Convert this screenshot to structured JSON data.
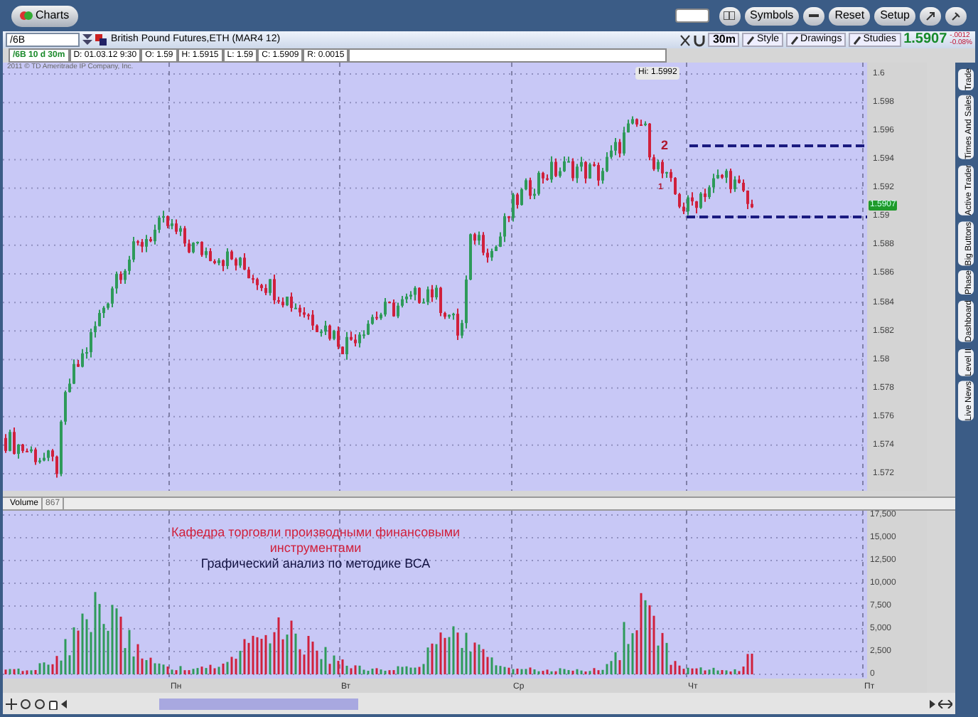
{
  "window": {
    "app_button": "Charts"
  },
  "header_buttons": [
    "Symbols",
    "Reset",
    "Setup"
  ],
  "symbol": {
    "value": "/6B",
    "description": "British Pound Futures,ETH (MAR4 12)"
  },
  "toolbar": {
    "aggregation": "30m",
    "buttons": [
      "Style",
      "Drawings",
      "Studies"
    ]
  },
  "quote": {
    "last": "1.5907",
    "change": "-.0012",
    "change_pct": "-0.08%"
  },
  "info_cells": [
    {
      "text": "/6B 10 d 30m",
      "kind": "title"
    },
    {
      "text": "D: 01.03.12 9:30",
      "kind": "plain"
    },
    {
      "text": "O: 1.59",
      "kind": "plain"
    },
    {
      "text": "H: 1.5915",
      "kind": "plain"
    },
    {
      "text": "L: 1.59",
      "kind": "plain"
    },
    {
      "text": "C: 1.5909",
      "kind": "plain"
    },
    {
      "text": "R: 0.0015",
      "kind": "plain"
    }
  ],
  "price_chart": {
    "copyright": "2011 © TD Ameritrade IP Company, Inc.",
    "high_label": "Hi: 1.5992",
    "markers": [
      "1",
      "2"
    ],
    "current_price": "1.5907",
    "axis_labels": [
      "1.6",
      "1.598",
      "1.596",
      "1.594",
      "1.592",
      "1.59",
      "1.588",
      "1.586",
      "1.584",
      "1.582",
      "1.58",
      "1.578",
      "1.576",
      "1.574",
      "1.572"
    ]
  },
  "volume_chart": {
    "title": "Volume",
    "value": "867",
    "annotation": {
      "line_1": "Кафедра торговли производными финансовыми инструментами",
      "line_2": "Графический анализ по методике ВСА"
    },
    "axis_labels": [
      "17,500",
      "15,000",
      "12,500",
      "10,000",
      "7,500",
      "5,000",
      "2,500",
      "0"
    ]
  },
  "day_labels": [
    "Пн",
    "Вт",
    "Ср",
    "Чт",
    "Пт"
  ],
  "side_tabs": [
    "Trade",
    "Times And Sales",
    "Active Trader",
    "Big Buttons",
    "Phase",
    "Dashboard",
    "Level II",
    "Live News"
  ]
}
